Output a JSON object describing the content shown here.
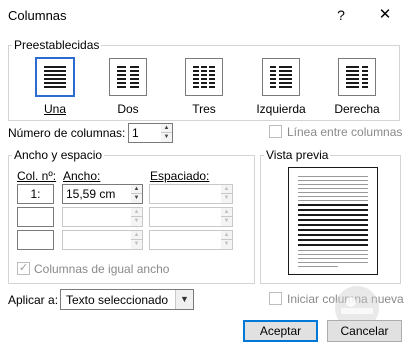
{
  "window": {
    "title": "Columnas",
    "help": "?",
    "close": "✕"
  },
  "presets": {
    "group_label": "Preestablecidas",
    "items": [
      {
        "label": "Una",
        "icon": "one-column-icon",
        "selected": true
      },
      {
        "label": "Dos",
        "icon": "two-columns-icon"
      },
      {
        "label": "Tres",
        "icon": "three-columns-icon"
      },
      {
        "label": "Izquierda",
        "icon": "left-column-icon"
      },
      {
        "label": "Derecha",
        "icon": "right-column-icon"
      }
    ]
  },
  "num_columns": {
    "label": "Número de columnas:",
    "value": "1"
  },
  "line_between": {
    "label": "Línea entre columnas",
    "checked": false,
    "enabled": false
  },
  "width_spacing": {
    "group_label": "Ancho y espacio",
    "col_header": "Col. nº:",
    "width_header": "Ancho:",
    "spacing_header": "Espaciado:",
    "rows": [
      {
        "col": "1:",
        "width": "15,59 cm",
        "spacing": ""
      },
      {
        "col": "",
        "width": "",
        "spacing": ""
      },
      {
        "col": "",
        "width": "",
        "spacing": ""
      }
    ]
  },
  "equal_width": {
    "label": "Columnas de igual ancho",
    "checked": true,
    "enabled": false
  },
  "preview": {
    "label": "Vista previa"
  },
  "apply_to": {
    "label": "Aplicar a:",
    "value": "Texto seleccionado"
  },
  "new_column": {
    "label": "Iniciar columna nueva",
    "checked": false,
    "enabled": false
  },
  "buttons": {
    "ok": "Aceptar",
    "cancel": "Cancelar"
  },
  "colors": {
    "accent": "#0078d7",
    "selected_border": "#2e6bd0",
    "disabled_text": "#8a8a8a"
  }
}
